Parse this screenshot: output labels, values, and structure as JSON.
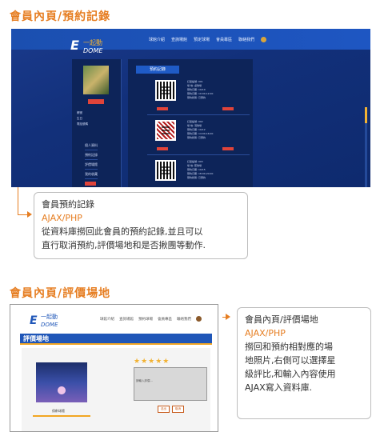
{
  "section1": {
    "heading": "會員內頁/預約記錄",
    "screenshot": {
      "logo_text": "E一起動DOME",
      "nav": [
        "球館介紹",
        "查詢場館",
        "預定球場",
        "會員專區",
        "聯絡我們"
      ],
      "profile": {
        "photo_button": "上傳",
        "info_lines": [
          "帳號",
          "生日",
          "電話號碼"
        ],
        "menu": [
          "個人資料",
          "預約記錄",
          "評價場館",
          "我的收藏"
        ],
        "logout": "登出"
      },
      "records_title": "預約記錄",
      "record_fields": [
        "訂單編號:",
        "場 地:",
        "預約日期:",
        "預約日期:",
        "預約狀態:"
      ],
      "record_values": [
        [
          "001",
          "桌球場",
          "10/10",
          "10:00-12:00",
          "已預約"
        ],
        [
          "002",
          "羽球場",
          "10/12",
          "14:00-16:00",
          "已預約"
        ],
        [
          "003",
          "籃球場",
          "10/15",
          "18:00-20:00",
          "已預約"
        ]
      ],
      "cancel_label": "取消預約",
      "rate_label": "評價場館"
    },
    "callout": {
      "title": "會員預約記錄",
      "tech": "AJAX/PHP",
      "desc_line1": "從資料庫撈回此會員的預約記錄,並且可以",
      "desc_line2": "直行取消預約,評價場地和是否揪團等動作."
    }
  },
  "section2": {
    "heading": "會員內頁/評價場地",
    "screenshot": {
      "logo_text": "E一起動DOME",
      "nav": [
        "球館介紹",
        "查詢場館",
        "預約球場",
        "會員專區",
        "聯絡我們"
      ],
      "band_title": "評價場地",
      "stars": "★★★★★",
      "comment_placeholder": "請輸入評價...",
      "photo_caption": "保齡球館",
      "submit_label": "送出",
      "cancel_label": "取消"
    },
    "callout": {
      "title": "會員內頁/評價場地",
      "tech": "AJAX/PHP",
      "desc_line1": "撈回和預約相對應的場",
      "desc_line2": "地照片,右側可以選擇星",
      "desc_line3": "級評比,和輸入內容使用",
      "desc_line4": "AJAX寫入資料庫."
    }
  }
}
